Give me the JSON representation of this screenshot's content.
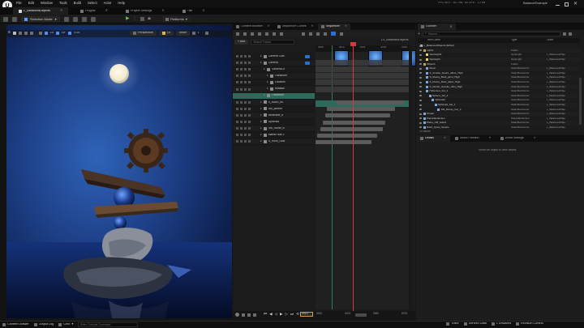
{
  "app": {
    "menu": [
      "File",
      "Edit",
      "Window",
      "Tools",
      "Build",
      "Select",
      "Actor",
      "Help"
    ],
    "project_title": "BalanceExample",
    "fps_readout": "FPS: 60.0 · 16.7 ms · 60 GPU · 1.2 ms",
    "window_controls": [
      "minimize",
      "maximize",
      "close"
    ]
  },
  "doc_tabs": [
    {
      "label": "L_BalancedObjects",
      "active": true
    },
    {
      "label": "Plugins",
      "active": false
    },
    {
      "label": "Project Settings",
      "active": false
    },
    {
      "label": "Fab",
      "active": false
    }
  ],
  "toolbar": {
    "mode_label": "Selection Mode",
    "platforms_label": "Platforms",
    "play_state": "stopped"
  },
  "viewport": {
    "tab_label": "Viewport 1",
    "perspective_label": "Perspective",
    "lit_label": "Lit",
    "show_label": "Show",
    "grid_snap": "10",
    "rot_snap": "10°",
    "scale_snap": "0.25",
    "camera_speed": "1"
  },
  "sequencer": {
    "tabs": [
      {
        "label": "Content Browser",
        "active": false
      },
      {
        "label": "Sequencer Curves",
        "active": false
      },
      {
        "label": "Sequencer",
        "active": true
      }
    ],
    "add_label": "+ Add",
    "search_placeholder": "Search Tracks",
    "sequence_name": "LS_BalancedObjects",
    "current_frame": "0013",
    "tracks": [
      {
        "label": "Camera Cuts",
        "indent": 0
      },
      {
        "label": "Camera",
        "indent": 0
      },
      {
        "label": "CameraCo",
        "indent": 1
      },
      {
        "label": "Transform",
        "indent": 2
      },
      {
        "label": "Location",
        "indent": 2
      },
      {
        "label": "Rotation",
        "indent": 2
      },
      {
        "label": "Transform",
        "indent": 1
      },
      {
        "label": "S_Moon_bo",
        "indent": 0
      },
      {
        "label": "SM_pebble",
        "indent": 0
      },
      {
        "label": "Helterane_b",
        "indent": 0
      },
      {
        "label": "Spheral4",
        "indent": 0
      },
      {
        "label": "SM_Stone_B",
        "indent": 0
      },
      {
        "label": "Marble Ball 2",
        "indent": 0
      },
      {
        "label": "S_Rock_Glas",
        "indent": 0
      }
    ],
    "bars": [
      {
        "row": 7,
        "start": 22,
        "end": 95
      },
      {
        "row": 8,
        "start": 12,
        "end": 85
      },
      {
        "row": 9,
        "start": 10,
        "end": 80
      },
      {
        "row": 10,
        "start": 8,
        "end": 75
      },
      {
        "row": 11,
        "start": 5,
        "end": 72
      },
      {
        "row": 12,
        "start": 2,
        "end": 66
      },
      {
        "row": 13,
        "start": 0,
        "end": 60
      }
    ],
    "playhead_percent": 40,
    "ruler_ticks": [
      "0000",
      "0010",
      "0020",
      "0030",
      "0040"
    ],
    "bottom_frames": [
      "0000",
      "0013",
      "0060",
      "0075"
    ]
  },
  "outliner": {
    "tab_label": "Outliner",
    "search_placeholder": "Search...",
    "columns": [
      "Item Label",
      "Type",
      "Level"
    ],
    "rows": [
      {
        "label": "L_BalancedObjects (Editor)",
        "type": "",
        "level": "",
        "indent": 0,
        "icon": "world-icon"
      },
      {
        "label": "Lights",
        "type": "Folder",
        "level": "",
        "indent": 1,
        "icon": "folder-icon"
      },
      {
        "label": "SpotLight2",
        "type": "SpotLight",
        "level": "L_BalancedObje",
        "indent": 2,
        "icon": "light-icon"
      },
      {
        "label": "SpotLight",
        "type": "SpotLight",
        "level": "L_BalancedObje",
        "indent": 2,
        "icon": "light-icon"
      },
      {
        "label": "Objects",
        "type": "Folder",
        "level": "",
        "indent": 1,
        "icon": "folder-icon"
      },
      {
        "label": "Moon",
        "type": "StaticMeshActor",
        "level": "L_BalancedObje",
        "indent": 2,
        "icon": "mesh-icon"
      },
      {
        "label": "S_Arcade_Gears_ufkne_High",
        "type": "StaticMeshActor",
        "level": "L_BalancedObje",
        "indent": 2,
        "icon": "mesh-icon"
      },
      {
        "label": "S_Mossy_Bark_jpcnt_High",
        "type": "StaticMeshActor",
        "level": "L_BalancedObje",
        "indent": 2,
        "icon": "mesh-icon"
      },
      {
        "label": "S_Mossy_Bark_pkpw_High",
        "type": "StaticMeshActor",
        "level": "L_BalancedObje",
        "indent": 2,
        "icon": "mesh-icon"
      },
      {
        "label": "S_Nordic_Granite_rhlm_High",
        "type": "StaticMeshActor",
        "level": "L_BalancedObje",
        "indent": 2,
        "icon": "mesh-icon"
      },
      {
        "label": "Helterane_bst_2",
        "type": "StaticMeshActor",
        "level": "L_BalancedObje",
        "indent": 2,
        "icon": "mesh-icon"
      },
      {
        "label": "Sphere_bst_2",
        "type": "StaticMeshActor",
        "level": "L_BalancedObje",
        "indent": 3,
        "icon": "mesh-icon"
      },
      {
        "label": "Spheral4",
        "type": "StaticMeshActor",
        "level": "L_BalancedObje",
        "indent": 4,
        "icon": "mesh-icon"
      },
      {
        "label": "Sphespe_bst_1",
        "type": "StaticMeshActor",
        "level": "L_BalancedObje",
        "indent": 5,
        "icon": "mesh-icon"
      },
      {
        "label": "SM_Mossy_bar_2",
        "type": "StaticMeshActor",
        "level": "L_BalancedObje",
        "indent": 6,
        "icon": "mesh-icon"
      },
      {
        "label": "Ocean",
        "type": "StaticMeshActor",
        "level": "L_BalancedObje",
        "indent": 1,
        "icon": "mesh-icon"
      },
      {
        "label": "PlanarReflection",
        "type": "PlanarReflection",
        "level": "L_BalancedObje",
        "indent": 1,
        "icon": "mesh-icon"
      },
      {
        "label": "Plane_cliff_island",
        "type": "StaticMeshActor",
        "level": "L_BalancedObje",
        "indent": 1,
        "icon": "mesh-icon"
      },
      {
        "label": "RAM_Quick_Simple",
        "type": "StaticMeshActor",
        "level": "L_BalancedObje",
        "indent": 1,
        "icon": "mesh-icon"
      }
    ],
    "count_label": "19 actors"
  },
  "details": {
    "tabs": [
      {
        "label": "Details",
        "active": true
      },
      {
        "label": "World Partition",
        "active": false
      },
      {
        "label": "World Settings",
        "active": false
      }
    ],
    "empty_text": "Select an object to view details."
  },
  "statusbar": {
    "content_drawer": "Content Drawer",
    "output_log": "Output Log",
    "cmd_label": "Cmd",
    "cmd_placeholder": "Enter Console Command",
    "trace": "Trace",
    "derived_data": "Derived Data",
    "unsaved": "1 Unsaved",
    "revision_control": "Revision Control"
  },
  "colors": {
    "accent_blue": "#2b6fd6",
    "playhead_red": "#d33a3a",
    "track_teal": "#2d6a5c",
    "panel_bg": "#1b1b1b"
  }
}
